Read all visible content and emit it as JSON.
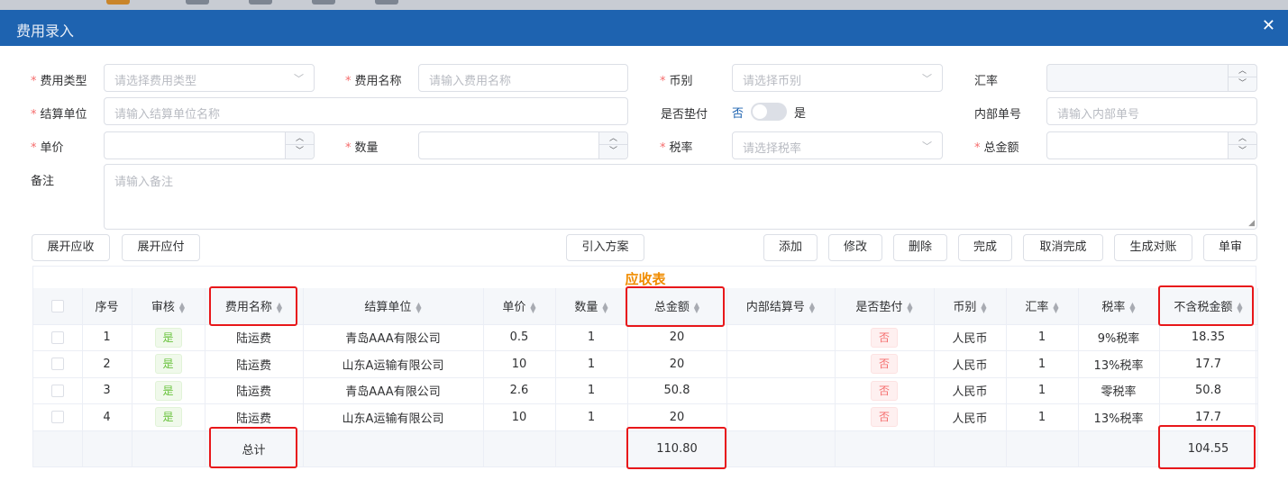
{
  "window": {
    "title": "费用录入",
    "close_icon": "✕"
  },
  "form": {
    "fee_type": {
      "label": "费用类型",
      "placeholder": "请选择费用类型"
    },
    "fee_name": {
      "label": "费用名称",
      "placeholder": "请输入费用名称"
    },
    "currency": {
      "label": "币别",
      "placeholder": "请选择币别"
    },
    "exchange_rate": {
      "label": "汇率",
      "value": ""
    },
    "settlement_unit": {
      "label": "结算单位",
      "placeholder": "请输入结算单位名称"
    },
    "advance": {
      "label": "是否垫付",
      "off_text": "否",
      "on_text": "是"
    },
    "internal_no": {
      "label": "内部单号",
      "placeholder": "请输入内部单号"
    },
    "unit_price": {
      "label": "单价",
      "value": ""
    },
    "quantity": {
      "label": "数量",
      "value": ""
    },
    "tax_rate": {
      "label": "税率",
      "placeholder": "请选择税率"
    },
    "total_amount": {
      "label": "总金额",
      "value": ""
    },
    "remark": {
      "label": "备注",
      "placeholder": "请输入备注"
    }
  },
  "buttons": {
    "expand_receivable": "展开应收",
    "expand_payable": "展开应付",
    "import_plan": "引入方案",
    "add": "添加",
    "modify": "修改",
    "delete": "删除",
    "complete": "完成",
    "cancel_complete": "取消完成",
    "generate_reconcile": "生成对账",
    "review": "单审"
  },
  "table": {
    "title": "应收表",
    "headers": {
      "index": "序号",
      "review": "审核",
      "fee_name": "费用名称",
      "settlement_unit": "结算单位",
      "unit_price": "单价",
      "quantity": "数量",
      "total": "总金额",
      "internal_no": "内部结算号",
      "advance": "是否垫付",
      "currency": "币别",
      "rate": "汇率",
      "tax": "税率",
      "net_amount": "不含税金额"
    },
    "rows": [
      {
        "index": "1",
        "review": "是",
        "fee_name": "陆运费",
        "unit": "青岛AAA有限公司",
        "price": "0.5",
        "qty": "1",
        "total": "20",
        "internal_no": "",
        "advance": "否",
        "currency": "人民币",
        "rate": "1",
        "tax": "9%税率",
        "net": "18.35"
      },
      {
        "index": "2",
        "review": "是",
        "fee_name": "陆运费",
        "unit": "山东A运输有限公司",
        "price": "10",
        "qty": "1",
        "total": "20",
        "internal_no": "",
        "advance": "否",
        "currency": "人民币",
        "rate": "1",
        "tax": "13%税率",
        "net": "17.7"
      },
      {
        "index": "3",
        "review": "是",
        "fee_name": "陆运费",
        "unit": "青岛AAA有限公司",
        "price": "2.6",
        "qty": "1",
        "total": "50.8",
        "internal_no": "",
        "advance": "否",
        "currency": "人民币",
        "rate": "1",
        "tax": "零税率",
        "net": "50.8"
      },
      {
        "index": "4",
        "review": "是",
        "fee_name": "陆运费",
        "unit": "山东A运输有限公司",
        "price": "10",
        "qty": "1",
        "total": "20",
        "internal_no": "",
        "advance": "否",
        "currency": "人民币",
        "rate": "1",
        "tax": "13%税率",
        "net": "17.7"
      }
    ],
    "summary": {
      "label": "总计",
      "total": "110.80",
      "net": "104.55"
    }
  },
  "colors": {
    "header_blue": "#1e63b0",
    "highlight_red": "#e8171a",
    "title_orange": "#f08c00"
  }
}
